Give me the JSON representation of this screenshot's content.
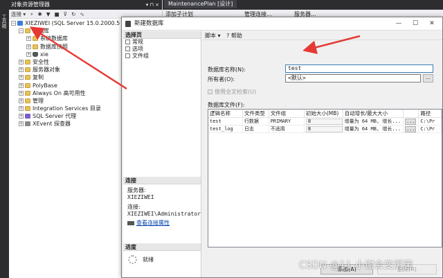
{
  "oe": {
    "title": "对象资源管理器",
    "title_buttons": "▾ ⊓ ×",
    "toolbar": {
      "connect": "连接 ▾"
    },
    "tree": [
      {
        "level": 0,
        "exp": "−",
        "icon": "server",
        "label": "XIEZIWEI (SQL Server 15.0.2000.5 - XIEZ"
      },
      {
        "level": 1,
        "exp": "−",
        "icon": "folder",
        "label": "数据库"
      },
      {
        "level": 2,
        "exp": "+",
        "icon": "folder",
        "label": "系统数据库"
      },
      {
        "level": 2,
        "exp": "+",
        "icon": "folder",
        "label": "数据库快照"
      },
      {
        "level": 2,
        "exp": "+",
        "icon": "db",
        "label": "xie"
      },
      {
        "level": 1,
        "exp": "+",
        "icon": "folder",
        "label": "安全性"
      },
      {
        "level": 1,
        "exp": "+",
        "icon": "folder",
        "label": "服务器对象"
      },
      {
        "level": 1,
        "exp": "+",
        "icon": "folder",
        "label": "复制"
      },
      {
        "level": 1,
        "exp": "+",
        "icon": "folder",
        "label": "PolyBase"
      },
      {
        "level": 1,
        "exp": "+",
        "icon": "folder",
        "label": "Always On 高可用性"
      },
      {
        "level": 1,
        "exp": "+",
        "icon": "folder",
        "label": "管理"
      },
      {
        "level": 1,
        "exp": "+",
        "icon": "folder",
        "label": "Integration Services 目录"
      },
      {
        "level": 1,
        "exp": "+",
        "icon": "agent",
        "label": "SQL Server 代理"
      },
      {
        "level": 1,
        "exp": "+",
        "icon": "xev",
        "label": "XEvent 探查器"
      }
    ]
  },
  "vstrip": {
    "label": "工具箱"
  },
  "bg": {
    "tab": "MaintenancePlan [设计]",
    "tb_addsub": "添加子计划",
    "tb_manage": "管理连接...",
    "tb_server": "服务器..."
  },
  "dialog": {
    "title": "新建数据库",
    "min": "—",
    "max": "☐",
    "close": "✕",
    "select_page": "选择页",
    "pages": [
      "常规",
      "选项",
      "文件组"
    ],
    "toolbar": {
      "script": "脚本 ▾",
      "help": "帮助"
    },
    "connection_head": "连接",
    "server_label": "服务器:",
    "server_value": "XIEZIWEI",
    "connection_label": "连接:",
    "connection_value": "XIEZIWEI\\Administrator",
    "view_conn_props": "查看连接属性",
    "progress_head": "进度",
    "progress_status": "就绪",
    "dbname_label": "数据库名称(N):",
    "dbname_value": "test",
    "owner_label": "所有者(O):",
    "owner_value": "<默认>",
    "browse": "...",
    "fulltext_label": "使用全文检索(U)",
    "db_files_label": "数据库文件(F):",
    "files": {
      "columns": [
        "逻辑名称",
        "文件类型",
        "文件组",
        "初始大小(MB)",
        "自动增长/最大大小",
        "",
        "路径"
      ],
      "rows": [
        [
          "test",
          "行数据",
          "PRIMARY",
          "8",
          "增量为 64 MB, 增长...",
          "...",
          "C:\\Pr"
        ],
        [
          "test_log",
          "日志",
          "不适用",
          "8",
          "增量为 64 MB, 增长...",
          "...",
          "C:\\Pr"
        ]
      ]
    },
    "add_button": "添加(A)",
    "remove_button": "删除(R)",
    "cancel_button": "取消"
  },
  "watermark": "CSDN @11 小谢会变厉害"
}
